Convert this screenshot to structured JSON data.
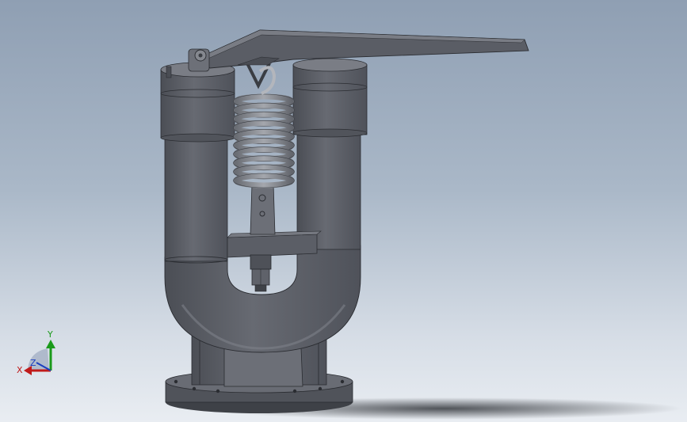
{
  "triad": {
    "x_label": "X",
    "y_label": "Y",
    "z_label": "Z",
    "colors": {
      "x": "#c01a1a",
      "y": "#1a9a1a",
      "z": "#1a3ec0"
    }
  },
  "model": {
    "body_color": "#5c5f67",
    "highlight_color": "#7a7e86",
    "edge_color": "#2a2c31"
  }
}
